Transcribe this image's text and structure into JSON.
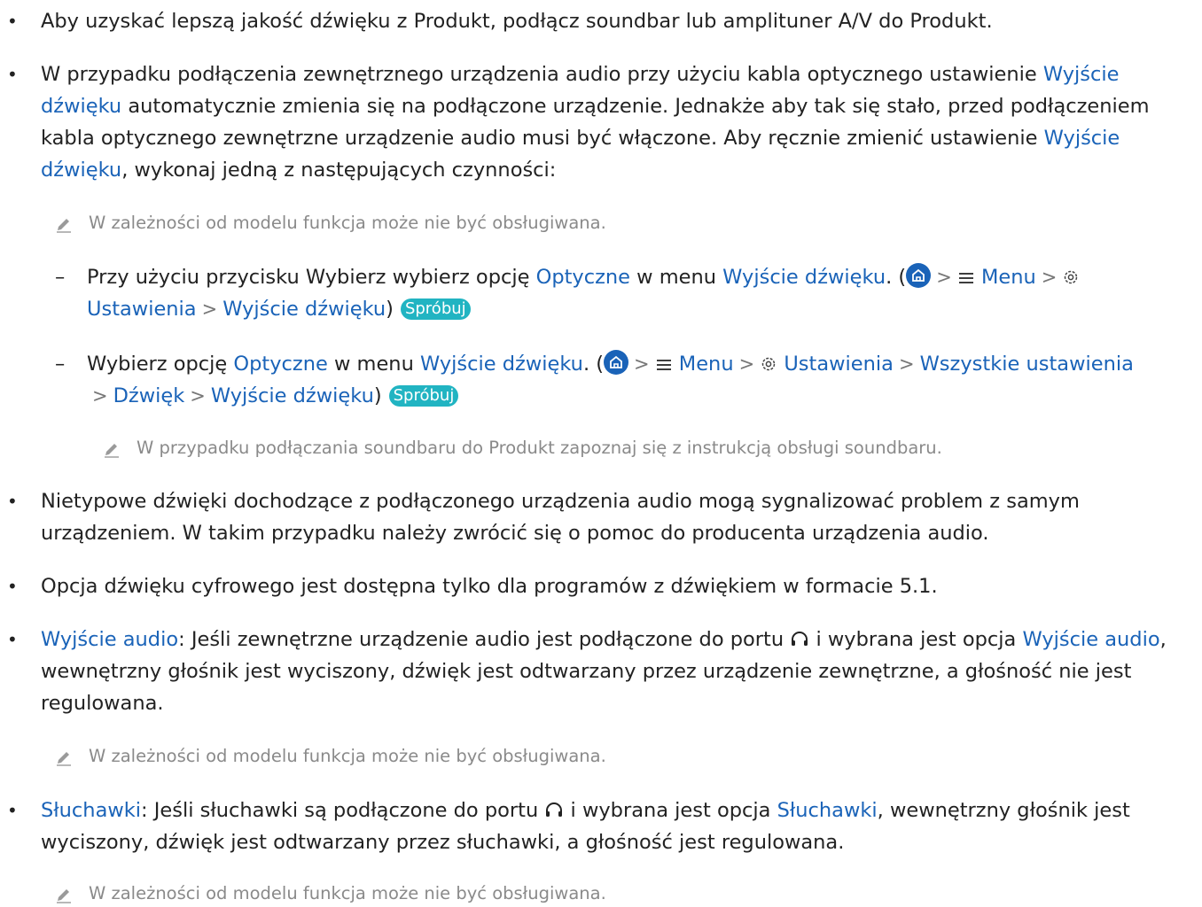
{
  "colors": {
    "link": "#1a63b8",
    "try_badge": "#21b4c2",
    "note": "#8a8a8a"
  },
  "bullet1": {
    "text": "Aby uzyskać lepszą jakość dźwięku z Produkt, podłącz soundbar lub amplituner A/V do Produkt."
  },
  "bullet2": {
    "p1": "W przypadku podłączenia zewnętrznego urządzenia audio przy użyciu kabla optycznego ustawienie ",
    "link1": "Wyjście dźwięku",
    "p2": " automatycznie zmienia się na podłączone urządzenie. Jednakże aby tak się stało, przed podłączeniem kabla optycznego zewnętrzne urządzenie audio musi być włączone. Aby ręcznie zmienić ustawienie ",
    "link2": "Wyjście dźwięku",
    "p3": ", wykonaj jedną z następujących czynności:"
  },
  "note_model": "W zależności od modelu funkcja może nie być obsługiwana.",
  "dash1": {
    "t1": "Przy użyciu przycisku Wybierz wybierz opcję ",
    "optyczne": "Optyczne",
    "t2": " w menu ",
    "wyjscie": "Wyjście dźwięku",
    "t3": ". (",
    "menu": "Menu",
    "ustawienia": "Ustawienia",
    "wyjscie2": "Wyjście dźwięku",
    "close": ")",
    "try": "Spróbuj"
  },
  "dash2": {
    "t1": "Wybierz opcję ",
    "optyczne": "Optyczne",
    "t2": " w menu ",
    "wyjscie": "Wyjście dźwięku",
    "t3": ". (",
    "menu": "Menu",
    "ustawienia": "Ustawienia",
    "wszystkie": "Wszystkie ustawienia",
    "dzwiek": "Dźwięk",
    "wyjscie2": "Wyjście dźwięku",
    "close": ")",
    "try": "Spróbuj"
  },
  "note_soundbar": "W przypadku podłączania soundbaru do Produkt zapoznaj się z instrukcją obsługi soundbaru.",
  "bullet3": {
    "text": "Nietypowe dźwięki dochodzące z podłączonego urządzenia audio mogą sygnalizować problem z samym urządzeniem. W takim przypadku należy zwrócić się o pomoc do producenta urządzenia audio."
  },
  "bullet4": {
    "text": "Opcja dźwięku cyfrowego jest dostępna tylko dla programów z dźwiękiem w formacie 5.1."
  },
  "bullet5": {
    "link1": "Wyjście audio",
    "t1": ": Jeśli zewnętrzne urządzenie audio jest podłączone do portu ",
    "t2": " i wybrana jest opcja ",
    "link2": "Wyjście audio",
    "t3": ", wewnętrzny głośnik jest wyciszony, dźwięk jest odtwarzany przez urządzenie zewnętrzne, a głośność nie jest regulowana."
  },
  "bullet6": {
    "link1": "Słuchawki",
    "t1": ": Jeśli słuchawki są podłączone do portu ",
    "t2": " i wybrana jest opcja ",
    "link2": "Słuchawki",
    "t3": ", wewnętrzny głośnik jest wyciszony, dźwięk jest odtwarzany przez słuchawki, a głośność jest regulowana."
  },
  "bullet_char": "•",
  "dash_char": "–",
  "sep_char": ">"
}
